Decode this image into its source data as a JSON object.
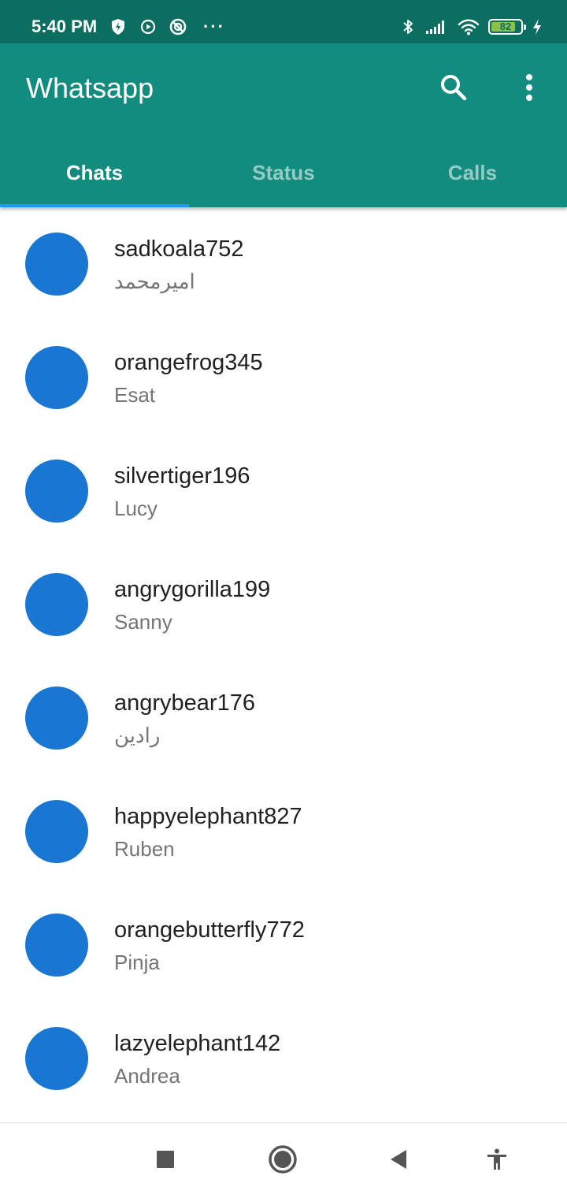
{
  "status_bar": {
    "time": "5:40 PM",
    "more_indicator": "···",
    "battery_level": "82",
    "battery_fraction": 0.82,
    "left_icons": [
      "shield-icon",
      "play-circle-icon",
      "blocked-circle-icon"
    ],
    "right_icons": [
      "bluetooth-icon",
      "signal-icon",
      "wifi-icon",
      "battery-icon",
      "charging-bolt-icon"
    ]
  },
  "app_bar": {
    "title": "Whatsapp",
    "actions": [
      "search-icon",
      "more-vert-icon"
    ]
  },
  "tabs": [
    {
      "label": "Chats",
      "active": true
    },
    {
      "label": "Status",
      "active": false
    },
    {
      "label": "Calls",
      "active": false
    }
  ],
  "chats": [
    {
      "name": "sadkoala752",
      "subtitle": "امیرمحمد"
    },
    {
      "name": "orangefrog345",
      "subtitle": "Esat"
    },
    {
      "name": "silvertiger196",
      "subtitle": "Lucy"
    },
    {
      "name": "angrygorilla199",
      "subtitle": "Sanny"
    },
    {
      "name": "angrybear176",
      "subtitle": "رادین"
    },
    {
      "name": "happyelephant827",
      "subtitle": "Ruben"
    },
    {
      "name": "orangebutterfly772",
      "subtitle": "Pinja"
    },
    {
      "name": "lazyelephant142",
      "subtitle": "Andrea"
    }
  ],
  "nav_bar": {
    "buttons": [
      "recents-square-icon",
      "home-circle-icon",
      "back-triangle-icon",
      "accessibility-icon"
    ]
  },
  "colors": {
    "status_bar": "#0c6e60",
    "app_bar": "#128c7e",
    "tab_indicator": "#2196f3",
    "avatar": "#1976d2",
    "battery_fill": "#8bc34a"
  }
}
